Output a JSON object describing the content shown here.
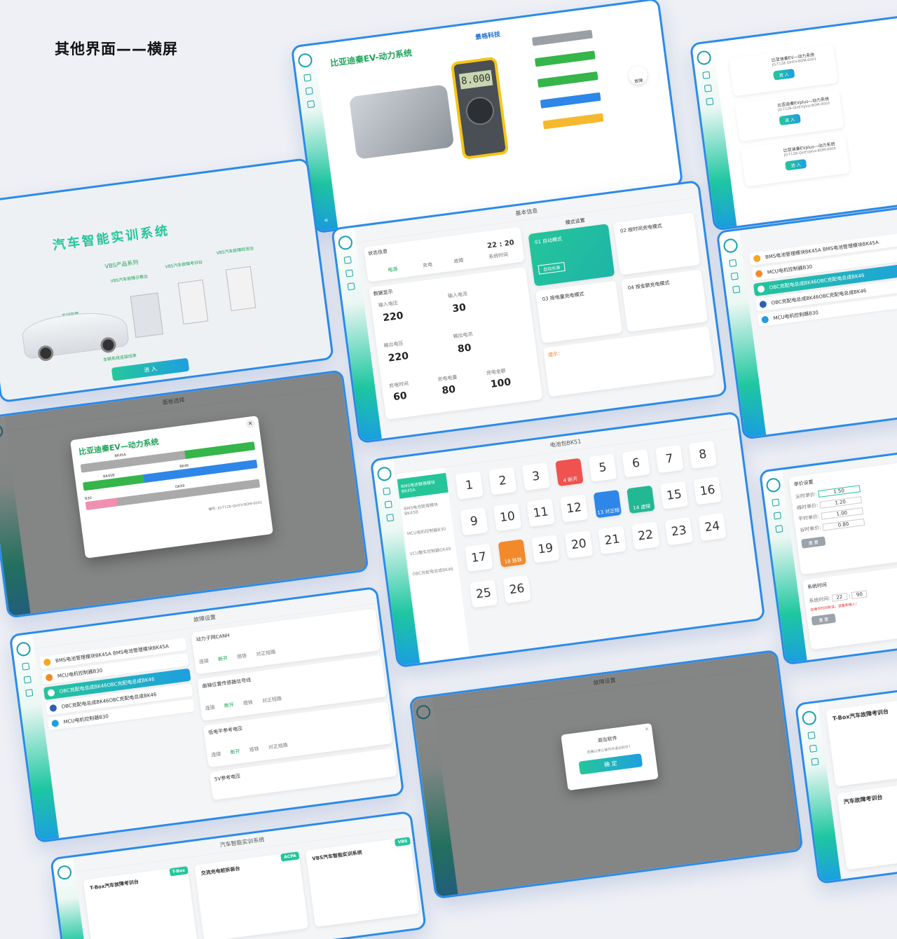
{
  "page_title": "其他界面——横屏",
  "colors": {
    "accent": "#1ec7a0",
    "brand_blue": "#2a8be8",
    "danger": "#f0524f",
    "warn": "#f28a2c"
  },
  "s1": {
    "title": "比亚迪秦EV-动力系统",
    "logo": "景格科技",
    "multimeter": "8.000",
    "panel_label": "故障"
  },
  "s2": {
    "items": [
      {
        "title": "比亚迪秦EV—动力系统",
        "code": "JG-T128-QinEV-BOM-0001",
        "button": "进 入"
      },
      {
        "title": "比亚迪秦EVplus—动力系统",
        "code": "JG-T128-QinEVplus-BOM-0003",
        "button": "进 入"
      },
      {
        "title": "比亚迪秦EVplus—动力系统",
        "code": "JG-T128-QinEVplus-BOM-0004",
        "button": "进 入"
      }
    ]
  },
  "s3": {
    "title": "汽车智能实训系统",
    "series": "VBS产品系列",
    "label_car": "实训车辆",
    "label_demo": "VBS汽车故障示教台",
    "label_exam": "VBS汽车故障考训台",
    "label_detect": "VBS汽车故障检测台",
    "label_conn": "车辆系统连接线束",
    "button": "进 入"
  },
  "s4": {
    "header": "基本信息",
    "status_title": "状态信息",
    "power": "电源",
    "charge": "充电",
    "fault": "故障",
    "time": "22 : 20",
    "time_label": "系统时间",
    "data_title": "数据显示",
    "in_v_label": "输入电压",
    "in_v": "220",
    "in_a_label": "输入电流",
    "in_a": "30",
    "out_v_label": "输出电压",
    "out_v": "220",
    "out_a_label": "输出电流",
    "out_a": "80",
    "ct_label": "充电时间",
    "ct": "60",
    "ce_label": "充电电量",
    "ce": "80",
    "cm_label": "充电金额",
    "cm": "100",
    "mode_title": "模式设置",
    "m1": "01 自动模式",
    "m1_btn": "自动充满",
    "m2": "02 按时间充电模式",
    "m3": "03 按电量充电模式",
    "m4": "04 按金额充电模式",
    "tip": "提示："
  },
  "s5": {
    "items": [
      "BMS电池管理模块BK45A BMS电池管理模块BK45A",
      "MCU电机控制器B30",
      "OBC充配电总成BK46OBC充配电总成BK46",
      "OBC充配电总成BK46OBC充配电总成BK46",
      "MCU电机控制器B30"
    ]
  },
  "s6": {
    "header": "面板选择",
    "popup_title": "比亚迪秦EV—动力系统",
    "c1": "BK45A",
    "c2": "BK45B",
    "c3": "BK46",
    "c4": "GK49",
    "c5": "B30",
    "code": "编号: JG-T128-QinEV-BOM-0001"
  },
  "s7": {
    "header": "电池包BK51",
    "side": [
      "BMS电池管理模块BK45A",
      "BMS电池管理模块BK45B",
      "MCU电机控制器B30",
      "VCU整车控制器GK49",
      "OBC充配电总成BK46"
    ],
    "nums": [
      "1",
      "2",
      "3",
      "4",
      "5",
      "6",
      "7",
      "8",
      "9",
      "10",
      "11",
      "12",
      "13",
      "14",
      "15",
      "16",
      "17",
      "18",
      "19",
      "20",
      "21",
      "22",
      "23",
      "24",
      "25",
      "26"
    ],
    "f4": "4 断开",
    "f13": "13 对正短路",
    "f14": "14 虚接",
    "f18": "18 搭铁"
  },
  "s8": {
    "title": "单价设置",
    "l1": "尖时单价:",
    "v1": "1.50",
    "l2": "峰时单价:",
    "v2": "1.20",
    "l3": "平时单价:",
    "v3": "1.00",
    "l4": "谷时单价:",
    "v4": "0.80",
    "reset": "重 置",
    "time_title": "系统时间",
    "time_label": "系统时间:",
    "h": "22",
    "m": "90",
    "warn": "如操作时间有误，请重新输入！"
  },
  "s9": {
    "header": "故障设置",
    "items": [
      "BMS电池管理模块BK45A BMS电池管理模块BK45A",
      "MCU电机控制器B30",
      "OBC充配电总成BK46OBC充配电总成BK46",
      "OBC充配电总成BK46OBC充配电总成BK46",
      "MCU电机控制器B30"
    ],
    "sig1": "动力子网CANH",
    "sig2": "曲轴位置传感器信号线",
    "sig3": "低电平参考电压",
    "sig4": "5V参考电压",
    "opt1": "连接",
    "opt2": "断开",
    "opt3": "搭铁",
    "opt4": "对正短路"
  },
  "s10": {
    "header": "故障设置",
    "dialog_title": "退出软件",
    "dialog_msg": "您确认停止操作并退出软件?",
    "dialog_btn": "确 定"
  },
  "s11": {
    "t1": "T-Box汽车故障考训台",
    "t2": "汽车故障考训台"
  },
  "s12": {
    "header": "汽车智能实训系统",
    "c1": "T-Box汽车故障考训台",
    "c2": "交流充电桩拆装台",
    "c3": "VBS汽车智能实训系统",
    "tag1": "T-Box",
    "tag2": "ACPA",
    "tag3": "VBS"
  }
}
